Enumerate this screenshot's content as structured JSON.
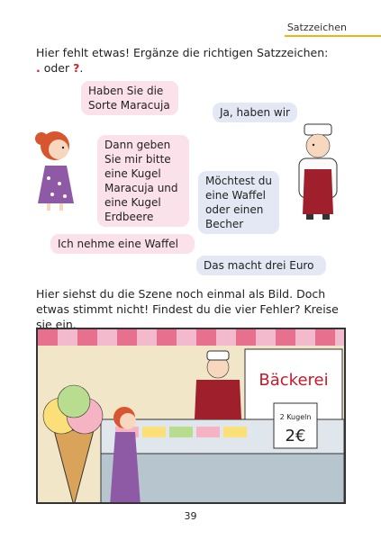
{
  "header": {
    "title": "Satzzeichen"
  },
  "instruction": {
    "line1": "Hier fehlt etwas! Ergänze die richtigen Satzzeichen:",
    "mark_dot": ".",
    "oder": " oder ",
    "mark_q": "?"
  },
  "dialog": [
    {
      "text": "Haben Sie die Sorte Maracuja"
    },
    {
      "text": "Ja, haben wir"
    },
    {
      "text": "Dann geben Sie mir bitte eine Kugel Maracuja und eine Kugel Erdbeere"
    },
    {
      "text": "Möchtest du eine Waffel oder einen Becher"
    },
    {
      "text": "Ich nehme eine Waffel"
    },
    {
      "text": "Das macht drei Euro"
    }
  ],
  "task2": {
    "text": "Hier siehst du die Szene noch einmal als Bild. Doch etwas stimmt nicht! Findest du die vier Fehler? Kreise sie ein."
  },
  "scene": {
    "shop_sign": "Bäckerei",
    "price_card_line1": "2 Kugeln",
    "price_card_line2": "2€"
  },
  "footer": {
    "page_number": "39"
  },
  "colors": {
    "accent_rule": "#f2b50f",
    "pink_bubble": "#fbe1ea",
    "blue_bubble": "#e3e8f4",
    "red_punctuation": "#d2232a"
  }
}
